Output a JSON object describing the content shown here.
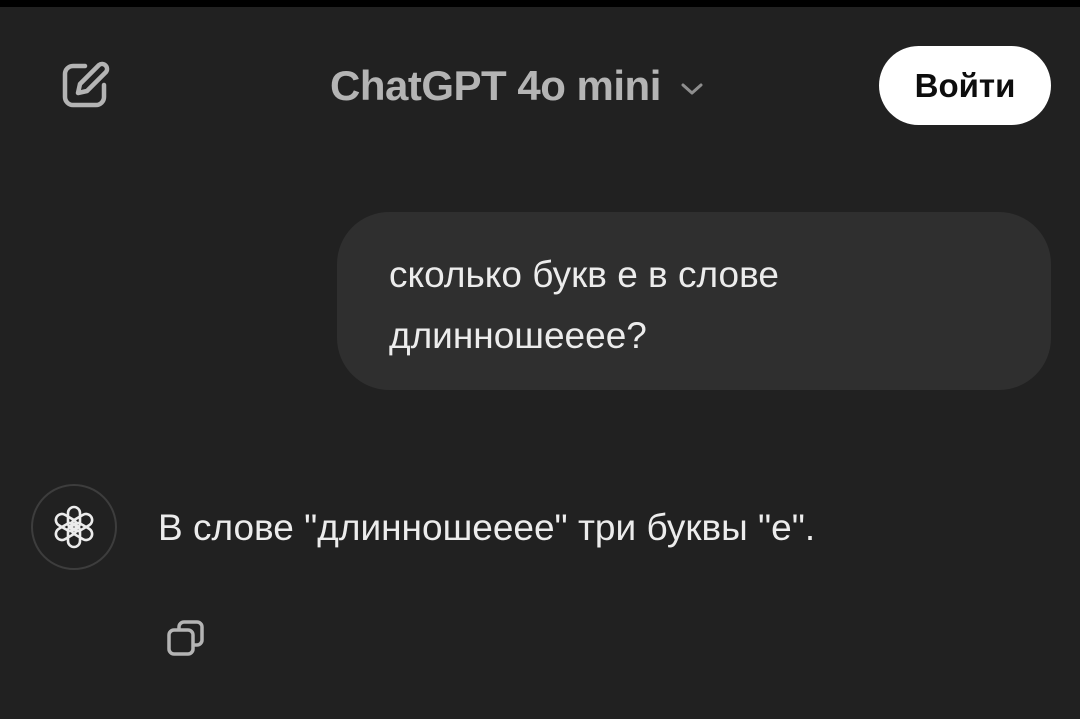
{
  "header": {
    "model_name": "ChatGPT 4o mini",
    "login_label": "Войти",
    "new_chat_icon": "edit-pencil-icon",
    "model_menu_icon": "chevron-down-icon"
  },
  "conversation": {
    "user_message": {
      "line1": "сколько букв е в слове",
      "line2": "длинношееее?"
    },
    "assistant_message": {
      "avatar_icon": "openai-logo-icon",
      "text": "В слове \"длинношееее\" три буквы \"е\".",
      "copy_icon": "copy-icon"
    }
  },
  "colors": {
    "background": "#212121",
    "user_bubble": "#2f2f2f",
    "text": "#ececec",
    "header_title": "#b4b4b4",
    "login_button_bg": "#ffffff"
  }
}
